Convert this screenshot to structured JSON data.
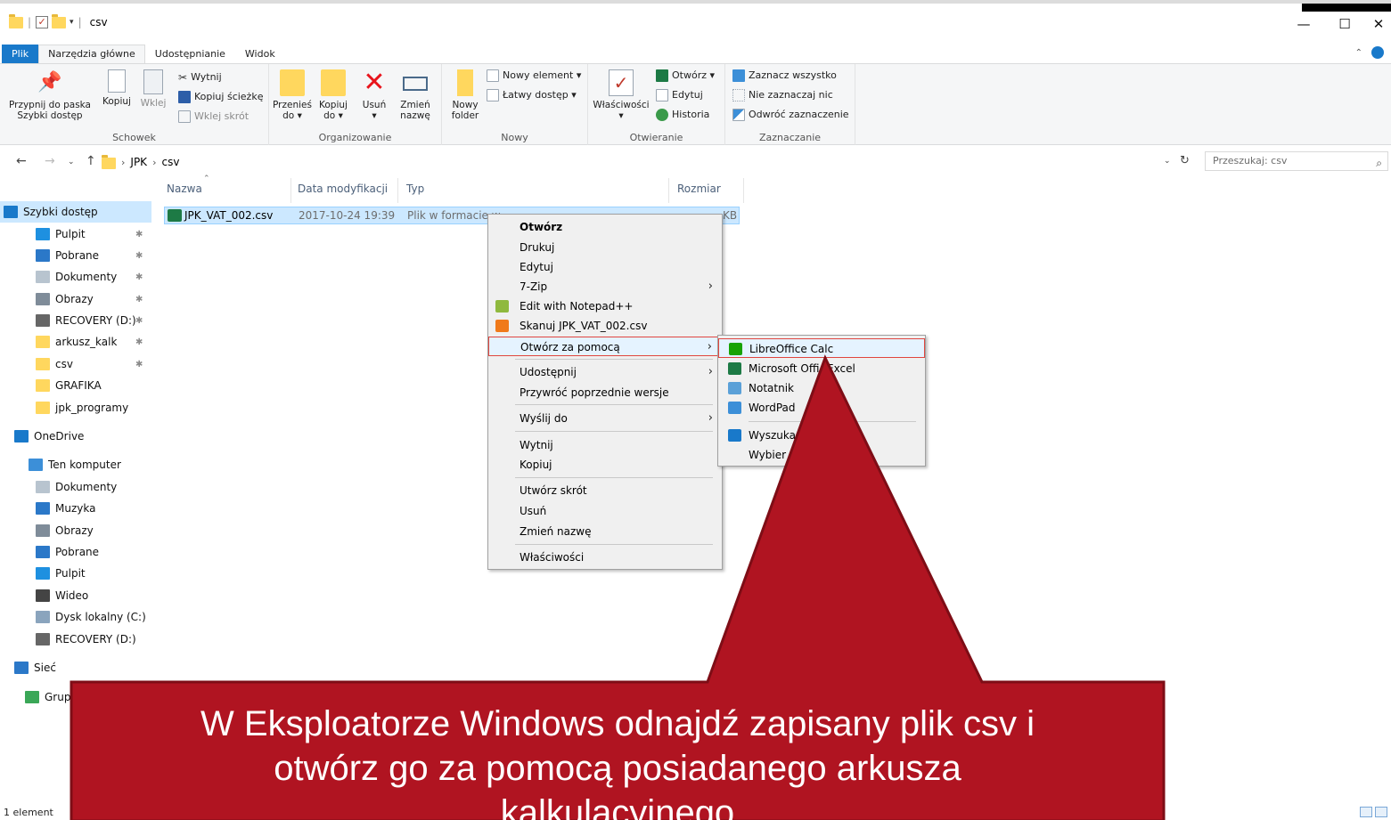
{
  "window": {
    "title": "csv",
    "controls": {
      "minimize": "—",
      "maximize": "☐",
      "close": "✕"
    }
  },
  "ribbon": {
    "tabs": [
      "Plik",
      "Narzędzia główne",
      "Udostępnianie",
      "Widok"
    ],
    "groups": {
      "schowek": {
        "label": "Schowek",
        "pin_label_1": "Przypnij do paska",
        "pin_label_2": "Szybki dostęp",
        "copy": "Kopiuj",
        "paste": "Wklej",
        "cut": "Wytnij",
        "copy_path": "Kopiuj ścieżkę",
        "paste_shortcut": "Wklej skrót"
      },
      "organizowanie": {
        "label": "Organizowanie",
        "move_1": "Przenieś",
        "move_2": "do ▾",
        "copyto_1": "Kopiuj",
        "copyto_2": "do ▾",
        "delete_1": "Usuń",
        "delete_2": "▾",
        "rename_1": "Zmień",
        "rename_2": "nazwę"
      },
      "nowy": {
        "label": "Nowy",
        "new_folder_1": "Nowy",
        "new_folder_2": "folder",
        "new_item": "Nowy element ▾",
        "easy_access": "Łatwy dostęp ▾"
      },
      "otwieranie": {
        "label": "Otwieranie",
        "properties_1": "Właściwości",
        "properties_2": "▾",
        "open": "Otwórz ▾",
        "edit": "Edytuj",
        "history": "Historia"
      },
      "zaznaczanie": {
        "label": "Zaznaczanie",
        "select_all": "Zaznacz wszystko",
        "select_none": "Nie zaznaczaj nic",
        "invert": "Odwróć zaznaczenie"
      }
    }
  },
  "address": {
    "breadcrumb": [
      "JPK",
      "csv"
    ],
    "search_placeholder": "Przeszukaj: csv"
  },
  "navpane": {
    "items": [
      {
        "label": "Szybki dostęp",
        "pinned": false,
        "selected": true,
        "color": "#1979ca"
      },
      {
        "label": "Pulpit",
        "pinned": true,
        "color": "#1e90e0"
      },
      {
        "label": "Pobrane",
        "pinned": true,
        "color": "#2b78c8"
      },
      {
        "label": "Dokumenty",
        "pinned": true,
        "color": "#b8c4cf"
      },
      {
        "label": "Obrazy",
        "pinned": true,
        "color": "#7f8c99"
      },
      {
        "label": "RECOVERY (D:)",
        "pinned": true,
        "color": "#666666"
      },
      {
        "label": "arkusz_kalk",
        "pinned": true,
        "color": "#ffd75e"
      },
      {
        "label": "csv",
        "pinned": true,
        "color": "#ffd75e"
      },
      {
        "label": "GRAFIKA",
        "pinned": false,
        "color": "#ffd75e"
      },
      {
        "label": "jpk_programy",
        "pinned": false,
        "color": "#ffd75e"
      },
      {
        "label": "OneDrive",
        "pinned": false,
        "color": "#1979ca"
      },
      {
        "label": "Ten komputer",
        "pinned": false,
        "color": "#3c8fd8"
      },
      {
        "label": "Dokumenty",
        "pinned": false,
        "color": "#b8c4cf"
      },
      {
        "label": "Muzyka",
        "pinned": false,
        "color": "#2b78c8"
      },
      {
        "label": "Obrazy",
        "pinned": false,
        "color": "#7f8c99"
      },
      {
        "label": "Pobrane",
        "pinned": false,
        "color": "#2b78c8"
      },
      {
        "label": "Pulpit",
        "pinned": false,
        "color": "#1e90e0"
      },
      {
        "label": "Wideo",
        "pinned": false,
        "color": "#444444"
      },
      {
        "label": "Dysk lokalny (C:)",
        "pinned": false,
        "color": "#8aa4bd"
      },
      {
        "label": "RECOVERY (D:)",
        "pinned": false,
        "color": "#666666"
      },
      {
        "label": "Sieć",
        "pinned": false,
        "color": "#2b78c8"
      },
      {
        "label": "Grup",
        "pinned": false,
        "color": "#3aa757"
      }
    ]
  },
  "filelist": {
    "columns": [
      "Nazwa",
      "Data modyfikacji",
      "Typ",
      "Rozmiar"
    ],
    "rows": [
      {
        "name": "JPK_VAT_002.csv",
        "modified": "2017-10-24 19:39",
        "type": "Plik w formacie w",
        "size": "KB"
      }
    ]
  },
  "context_menu": {
    "items": [
      "Otwórz",
      "Drukuj",
      "Edytuj",
      "7-Zip",
      "Edit with Notepad++",
      "Skanuj JPK_VAT_002.csv",
      "Otwórz za pomocą",
      "Udostępnij",
      "Przywróć poprzednie wersje",
      "Wyślij do",
      "Wytnij",
      "Kopiuj",
      "Utwórz skrót",
      "Usuń",
      "Zmień nazwę",
      "Właściwości"
    ]
  },
  "submenu": {
    "items": [
      "LibreOffice Calc",
      "Microsoft Offi",
      "Excel",
      "Notatnik",
      "WordPad",
      "Wyszuka",
      "Wybier"
    ]
  },
  "statusbar": {
    "count": "1 element"
  },
  "callout": {
    "line1": "W Eksploatorze Windows odnajdź zapisany plik csv i",
    "line2": "otwórz go za pomocą posiadanego arkusza",
    "line3": "kalkulacyjnego",
    "fill": "#b01421",
    "border": "#7e0d16"
  }
}
